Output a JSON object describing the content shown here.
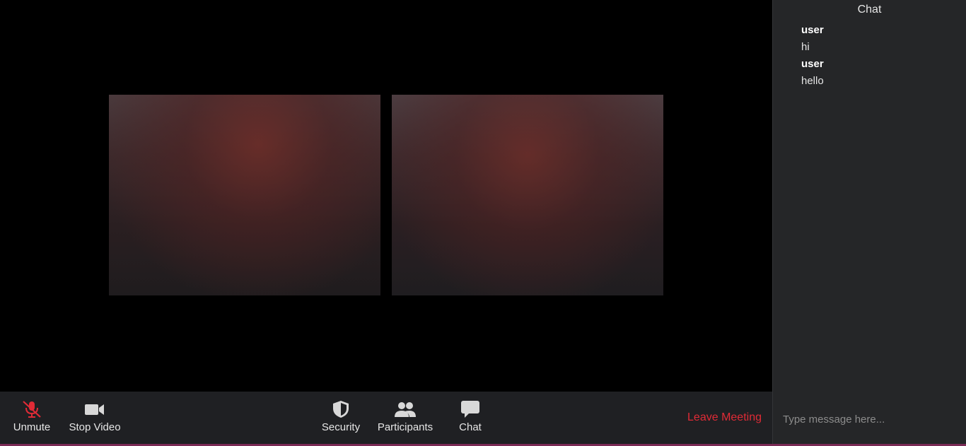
{
  "toolbar": {
    "unmute_label": "Unmute",
    "stop_video_label": "Stop Video",
    "security_label": "Security",
    "participants_label": "Participants",
    "chat_label": "Chat",
    "leave_label": "Leave Meeting"
  },
  "chat": {
    "title": "Chat",
    "messages": [
      {
        "sender": "user",
        "text": "hi"
      },
      {
        "sender": "user",
        "text": "hello"
      }
    ],
    "input_placeholder": "Type message here..."
  },
  "colors": {
    "muted_icon": "#e02b36",
    "leave": "#e02b36",
    "toolbar_bg": "#1f2023",
    "panel_bg": "#252628"
  },
  "icons": {
    "unmute": "microphone-muted-icon",
    "video": "video-camera-icon",
    "security": "shield-icon",
    "participants": "people-icon",
    "chat": "chat-bubble-icon"
  }
}
